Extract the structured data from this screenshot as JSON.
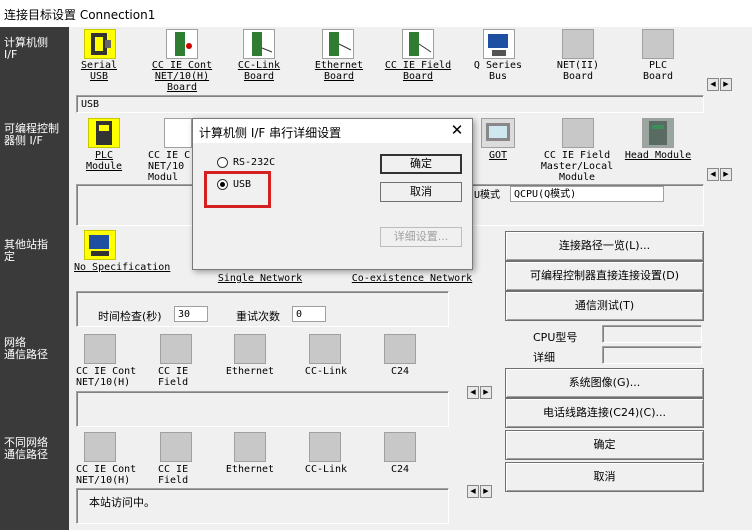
{
  "window": {
    "title": "连接目标设置 Connection1"
  },
  "left_labels": {
    "pc_if": [
      "计算机侧",
      "I/F"
    ],
    "plc_if": [
      "可编程控制",
      "器侧 I/F"
    ],
    "other_station": [
      "其他站指",
      "定"
    ],
    "network_route": [
      "网络",
      "通信路径"
    ],
    "diff_network": [
      "不同网络",
      "通信路径"
    ]
  },
  "pc_if_icons": [
    {
      "label": "Serial\nUSB",
      "underline": true
    },
    {
      "label": "CC IE Cont\nNET/10(H)\nBoard",
      "underline": true
    },
    {
      "label": "CC-Link\nBoard",
      "underline": true
    },
    {
      "label": "Ethernet\nBoard",
      "underline": true
    },
    {
      "label": "CC IE Field\nBoard",
      "underline": true
    },
    {
      "label": "Q Series\nBus",
      "underline": false
    },
    {
      "label": "NET(II)\nBoard",
      "underline": false
    },
    {
      "label": "PLC\nBoard",
      "underline": false
    }
  ],
  "pc_if_value": "USB",
  "plc_if_icons": [
    {
      "label": "PLC\nModule",
      "underline": true
    },
    {
      "label": "CC IE C\nNET/10\nModul",
      "underline": false
    },
    {
      "label": "GOT",
      "underline": true
    },
    {
      "label": "CC IE Field\nMaster/Local\nModule",
      "underline": false
    },
    {
      "label": "Head Module",
      "underline": true
    }
  ],
  "plc_mode_label": "U模式",
  "plc_mode_value": "QCPU(Q模式)",
  "other_station": {
    "icon_label": "No Specification",
    "single_network": "Single Network",
    "coexistence_network": "Co-existence Network",
    "time_check_label": "时间检查(秒)",
    "time_check_value": "30",
    "retry_label": "重试次数",
    "retry_value": "0"
  },
  "network_icons": [
    "CC IE Cont\nNET/10(H)",
    "CC IE\nField",
    "Ethernet",
    "CC-Link",
    "C24"
  ],
  "diff_network_icons": [
    "CC IE Cont\nNET/10(H)",
    "CC IE\nField",
    "Ethernet",
    "CC-Link",
    "C24"
  ],
  "status_text": "本站访问中。",
  "right_buttons": {
    "route_list": "连接路径一览(L)...",
    "direct_connect": "可编程控制器直接连接设置(D)",
    "comm_test": "通信测试(T)",
    "cpu_type_label": "CPU型号",
    "detail_label": "详细",
    "system_image": "系统图像(G)...",
    "phone_line": "电话线路连接(C24)(C)...",
    "ok": "确定",
    "cancel": "取消"
  },
  "dialog": {
    "title": "计算机侧 I/F 串行详细设置",
    "close": "✕",
    "option_rs232c": "RS-232C",
    "option_usb": "USB",
    "selected": "USB",
    "ok": "确定",
    "cancel": "取消",
    "detail": "详细设置..."
  },
  "colors": {
    "left_panel": "#3a3a3a",
    "highlight": "#d42020",
    "icon_yellow": "#ffff00",
    "link_blue": "#000080"
  }
}
